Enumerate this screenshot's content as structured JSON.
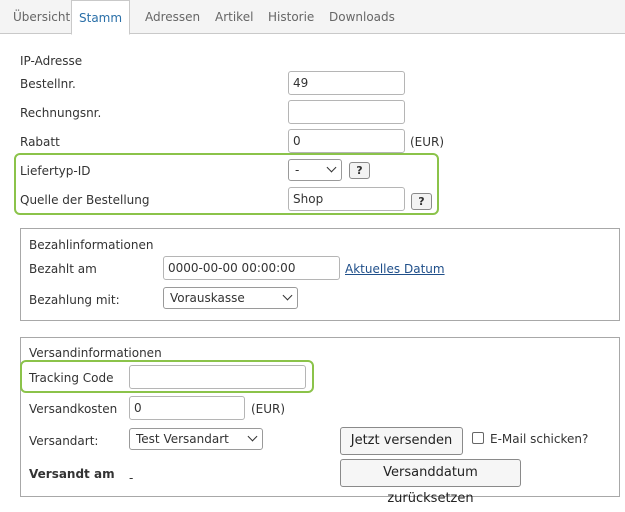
{
  "tabs": [
    "Übersicht",
    "Stamm",
    "Adressen",
    "Artikel",
    "Historie",
    "Downloads"
  ],
  "active_tab": "Stamm",
  "stamm": {
    "ip_label": "IP-Adresse",
    "bestellnr_label": "Bestellnr.",
    "bestellnr_value": "49",
    "rechnungsnr_label": "Rechnungsnr.",
    "rechnungsnr_value": "",
    "rabatt_label": "Rabatt",
    "rabatt_value": "0",
    "rabatt_unit": "(EUR)",
    "liefertyp_label": "Liefertyp-ID",
    "liefertyp_value": "-",
    "quelle_label": "Quelle der Bestellung",
    "quelle_value": "Shop",
    "help_glyph": "?"
  },
  "bezahl": {
    "legend": "Bezahlinformationen",
    "bezahlt_am_label": "Bezahlt am",
    "bezahlt_am_value": "0000-00-00 00:00:00",
    "aktuelles_datum_link": "Aktuelles Datum",
    "bezahlung_mit_label": "Bezahlung mit:",
    "bezahlung_mit_value": "Vorauskasse"
  },
  "versand": {
    "legend": "Versandinformationen",
    "tracking_label": "Tracking Code",
    "tracking_value": "",
    "versandkosten_label": "Versandkosten",
    "versandkosten_value": "0",
    "versandkosten_unit": "(EUR)",
    "versandart_label": "Versandart:",
    "versandart_value": "Test Versandart",
    "jetzt_versenden_button": "Jetzt versenden",
    "email_checkbox_label": "E-Mail schicken?",
    "email_checked": false,
    "versandt_am_label": "Versandt am",
    "versandt_am_value": "-",
    "reset_button": "Versanddatum zurücksetzen"
  },
  "colors": {
    "highlight": "#8bc34a",
    "active_tab_text": "#2a6fa8",
    "link": "#1f4f8a"
  }
}
